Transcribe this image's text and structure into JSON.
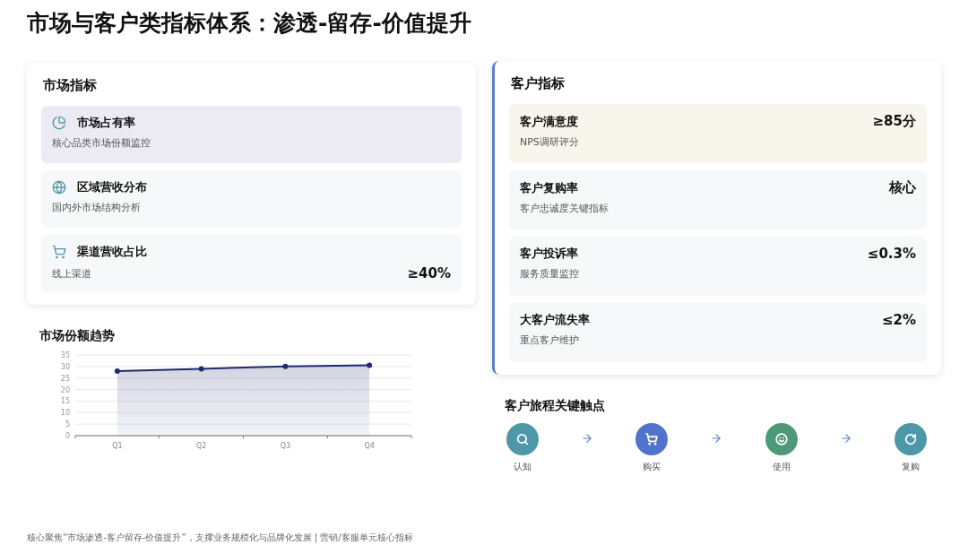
{
  "title": "市场与客户类指标体系：渗透-留存-价值提升",
  "market": {
    "heading": "市场指标",
    "items": [
      {
        "name": "市场占有率",
        "desc": "核心品类市场份额监控",
        "selected": true
      },
      {
        "name": "区域营收分布",
        "desc": "国内外市场结构分析",
        "selected": false
      },
      {
        "name": "渠道营收占比",
        "desc": "线上渠道",
        "value": "≥40%",
        "selected": false
      }
    ]
  },
  "trend": {
    "heading": "市场份额趋势",
    "chart_data": {
      "type": "area",
      "categories": [
        "Q1",
        "Q2",
        "Q3",
        "Q4"
      ],
      "grid": true,
      "series": [
        {
          "color": "#1f2a6e",
          "values": [
            28,
            29,
            30,
            30.5
          ]
        }
      ],
      "ylim": [
        0,
        35
      ],
      "yticks": [
        0,
        5,
        10,
        15,
        20,
        25,
        30,
        35
      ]
    }
  },
  "customer": {
    "heading": "客户指标",
    "items": [
      {
        "name": "客户满意度",
        "desc": "NPS调研评分",
        "value": "≥85分",
        "selected": true
      },
      {
        "name": "客户复购率",
        "desc": "客户忠诚度关键指标",
        "value": "核心",
        "selected": false
      },
      {
        "name": "客户投诉率",
        "desc": "服务质量监控",
        "value": "≤0.3%",
        "selected": false
      },
      {
        "name": "大客户流失率",
        "desc": "重点客户维护",
        "value": "≤2%",
        "selected": false
      }
    ]
  },
  "journey": {
    "heading": "客户旅程关键触点",
    "steps": [
      {
        "label": "认知",
        "color": "#4e97a8"
      },
      {
        "label": "购买",
        "color": "#5173cc"
      },
      {
        "label": "使用",
        "color": "#4e9a78"
      },
      {
        "label": "复购",
        "color": "#4e97a8"
      }
    ]
  },
  "footer": "核心聚焦“市场渗透-客户留存-价值提升”，支撑业务规模化与品牌化发展 | 营销/客服单元核心指标"
}
